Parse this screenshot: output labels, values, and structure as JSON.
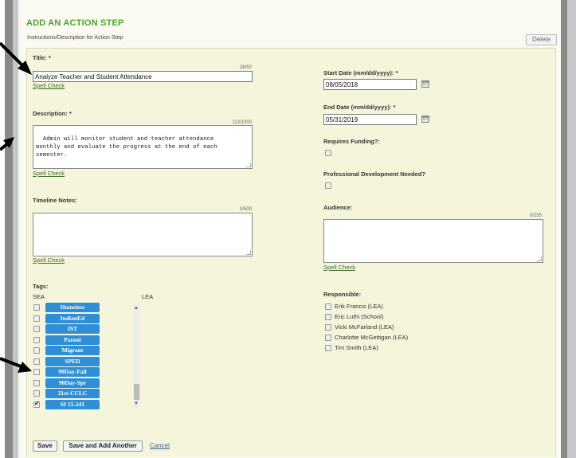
{
  "header": {
    "title": "ADD AN ACTION STEP",
    "instructions": "Instructions/Description for Action Step",
    "delete_label": "Delete"
  },
  "form": {
    "title": {
      "label": "Title: *",
      "counter": "38/50",
      "value": "Analyze Teacher and Student Attendance",
      "spell_check": "Spell Check"
    },
    "description": {
      "label": "Description: *",
      "counter": "113/1000",
      "value": "Admin will monitor student and teacher attendance\nmonthly and evaluate the progress at the end of each\nsemester.",
      "spell_check": "Spell Check"
    },
    "timeline": {
      "label": "Timeline Notes:",
      "counter": "0/500",
      "value": "",
      "spell_check": "Spell Check"
    },
    "start_date": {
      "label": "Start Date (mm/dd/yyyy): *",
      "value": "08/05/2018"
    },
    "end_date": {
      "label": "End Date (mm/dd/yyyy): *",
      "value": "05/31/2019"
    },
    "requires_funding": {
      "label": "Requires Funding?:",
      "checked": false
    },
    "pd_needed": {
      "label": "Professional Development Needed?",
      "checked": false
    },
    "audience": {
      "label": "Audience:",
      "counter": "0/255",
      "value": "",
      "spell_check": "Spell Check"
    },
    "tags": {
      "label": "Tags:",
      "sea_label": "SEA",
      "lea_label": "LEA",
      "items": [
        {
          "label": "Homeless",
          "checked": false
        },
        {
          "label": "IndianEd",
          "checked": false
        },
        {
          "label": "IST",
          "checked": false
        },
        {
          "label": "Parent",
          "checked": false
        },
        {
          "label": "Migrant",
          "checked": false
        },
        {
          "label": "SPED",
          "checked": false
        },
        {
          "label": "90Day-Fall",
          "checked": false
        },
        {
          "label": "90Day-Spr",
          "checked": false
        },
        {
          "label": "21st-CCLC",
          "checked": false
        },
        {
          "label": "SI 15-241",
          "checked": true
        }
      ]
    },
    "responsible": {
      "label": "Responsible:",
      "items": [
        {
          "name": "Erik Francis (LEA)",
          "checked": false
        },
        {
          "name": "Eric Luthi (School)",
          "checked": false
        },
        {
          "name": "Vicki McFarland (LEA)",
          "checked": false
        },
        {
          "name": "Charlotte McGettigan (LEA)",
          "checked": false
        },
        {
          "name": "Tim Smith (LEA)",
          "checked": false
        }
      ]
    }
  },
  "actions": {
    "save": "Save",
    "save_add": "Save and Add Another",
    "cancel": "Cancel"
  },
  "colors": {
    "title_green": "#4aa52a",
    "tag_blue": "#2e8fd6",
    "form_bg": "#f5f5dc"
  }
}
